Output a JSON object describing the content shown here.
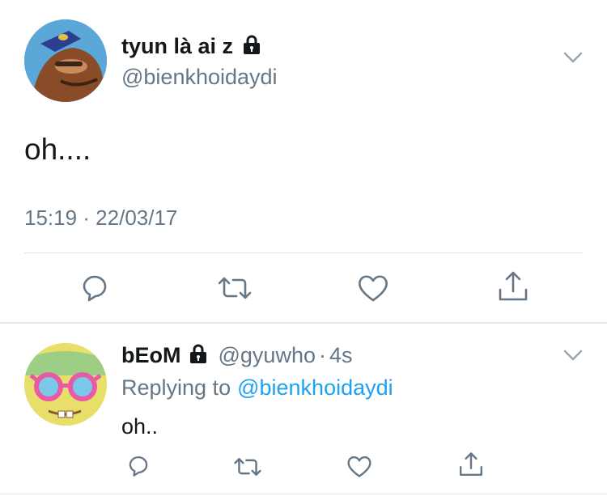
{
  "colors": {
    "accent": "#1da1f2",
    "muted": "#657786",
    "text": "#14171a",
    "divider": "#e1e8ed"
  },
  "main_tweet": {
    "avatar_icon": "cartoon-fish-avatar",
    "display_name": "tyun là ai z",
    "lock_icon": "lock-icon",
    "handle": "@bienkhoidaydi",
    "text": "oh....",
    "timestamp": "15:19 · 22/03/17",
    "actions": [
      "reply-icon",
      "retweet-icon",
      "like-icon",
      "share-icon"
    ]
  },
  "reply_tweet": {
    "avatar_icon": "spongebob-sunglasses-avatar",
    "display_name": "bEoM",
    "lock_icon": "lock-icon",
    "handle": "@gyuwho",
    "time_sep": "·",
    "time": "4s",
    "replying_prefix": "Replying to",
    "replying_handle": "@bienkhoidaydi",
    "text": "oh..",
    "actions": [
      "reply-icon",
      "retweet-icon",
      "like-icon",
      "share-icon"
    ]
  }
}
